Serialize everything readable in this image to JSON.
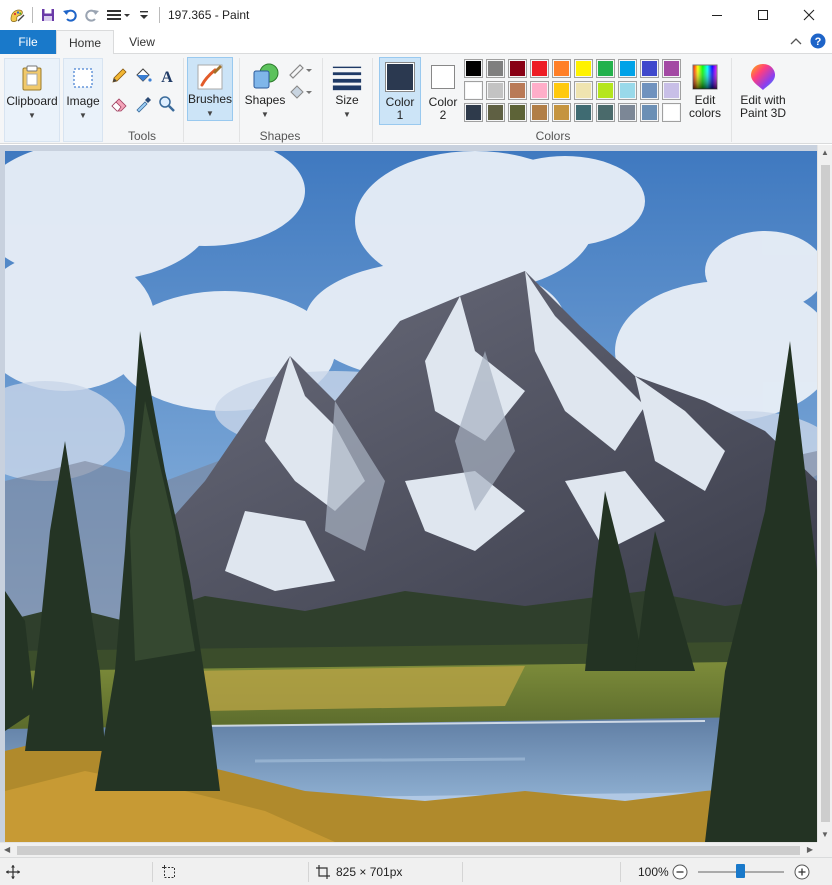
{
  "window": {
    "title": "197.365 - Paint"
  },
  "tabs": {
    "file": "File",
    "home": "Home",
    "view": "View"
  },
  "ribbon": {
    "clipboard_label": "Clipboard",
    "image_label": "Image",
    "tools_label": "Tools",
    "brushes_label": "Brushes",
    "shapes_button_label": "Shapes",
    "shapes_group_label": "Shapes",
    "size_label": "Size",
    "color1_label_line1": "Color",
    "color1_label_line2": "1",
    "color2_label_line1": "Color",
    "color2_label_line2": "2",
    "colors_group_label": "Colors",
    "edit_colors_line1": "Edit",
    "edit_colors_line2": "colors",
    "paint3d_line1": "Edit with",
    "paint3d_line2": "Paint 3D"
  },
  "colors": {
    "color1": "#2b3950",
    "color2": "#ffffff",
    "palette_row1": [
      "#000000",
      "#7f7f7f",
      "#880015",
      "#ed1c24",
      "#ff7f27",
      "#fff200",
      "#22b14c",
      "#00a2e8",
      "#3f48cc",
      "#a349a4"
    ],
    "palette_row2": [
      "#ffffff",
      "#c3c3c3",
      "#b97a57",
      "#ffaec9",
      "#ffc90e",
      "#efe4b0",
      "#b5e61d",
      "#99d9ea",
      "#7092be",
      "#c8bfe7"
    ],
    "palette_row3": [
      "#2e3a4b",
      "#5f6043",
      "#5d6337",
      "#b17e47",
      "#c5943f",
      "#3f6b72",
      "#4a6a6b",
      "#7c8796",
      "#6b8fb5",
      "#ffffff"
    ]
  },
  "status": {
    "dimensions": "825 × 701px",
    "zoom": "100%"
  }
}
